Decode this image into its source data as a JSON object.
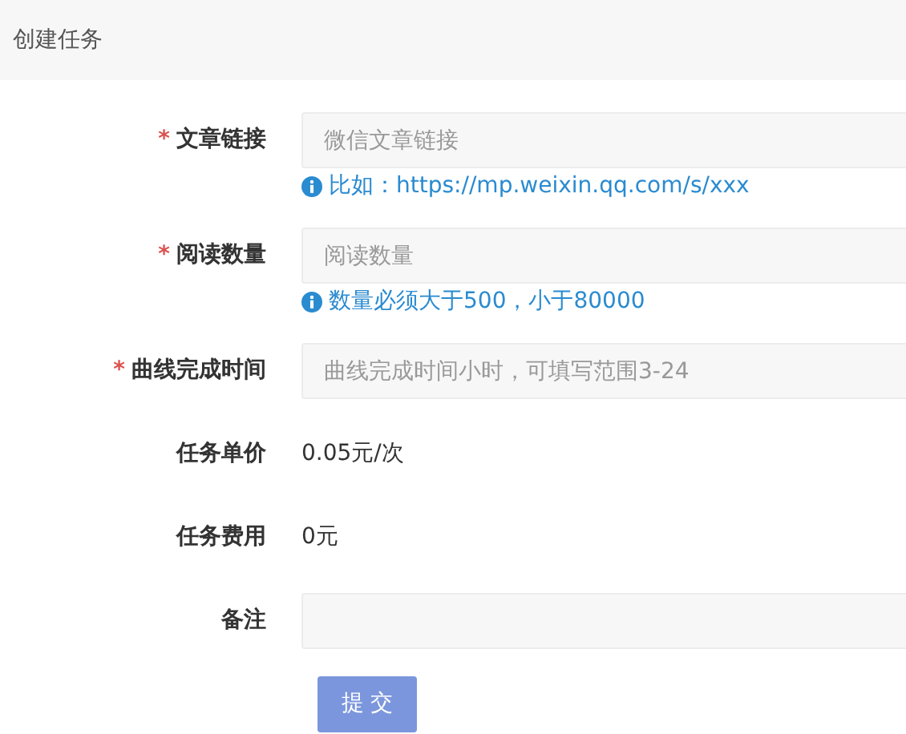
{
  "header": {
    "title": "创建任务"
  },
  "form": {
    "rows": [
      {
        "kind": "input",
        "required_mark": "*",
        "label": "文章链接",
        "placeholder": "微信文章链接",
        "hint": "比如：https://mp.weixin.qq.com/s/xxx"
      },
      {
        "kind": "input",
        "required_mark": "*",
        "label": "阅读数量",
        "placeholder": "阅读数量",
        "hint": "数量必须大于500，小于80000"
      },
      {
        "kind": "input",
        "required_mark": "*",
        "label": "曲线完成时间",
        "placeholder": "曲线完成时间小时，可填写范围3-24"
      },
      {
        "kind": "static",
        "label": "任务单价",
        "value": "0.05元/次"
      },
      {
        "kind": "static",
        "label": "任务费用",
        "value": "0元"
      },
      {
        "kind": "input",
        "label": "备注"
      }
    ],
    "submit": "提 交"
  }
}
